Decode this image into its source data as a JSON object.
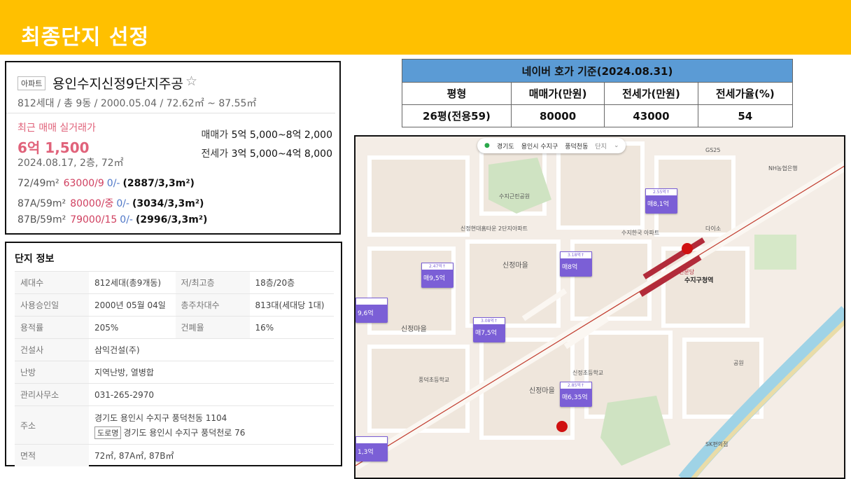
{
  "slide_title": "최종단지 선정",
  "listing": {
    "badge": "아파트",
    "name": "용인수지신정9단지주공",
    "summary": "812세대 / 총 9동 / 2000.05.04 / 72.62㎡ ~ 87.55㎡",
    "recent_label": "최근 매매 실거래가",
    "recent_price": "6억 1,500",
    "recent_date": "2024.08.17, 2층, 72㎡",
    "sale_range_label": "매매가",
    "sale_range": "5억 5,000~8억 2,000",
    "jeonse_range_label": "전세가",
    "jeonse_range": "3억 5,000~4억 8,000",
    "units": [
      {
        "type": "72/49m²",
        "sale": "63000/9",
        "jeonse": "0/-",
        "per": "(2887/3,3m²)"
      },
      {
        "type": "87A/59m²",
        "sale": "80000/중",
        "jeonse": "0/-",
        "per": "(3034/3,3m²)"
      },
      {
        "type": "87B/59m²",
        "sale": "79000/15",
        "jeonse": "0/-",
        "per": "(2996/3,3m²)"
      }
    ]
  },
  "complex_info": {
    "header": "단지 정보",
    "rows": [
      {
        "k1": "세대수",
        "v1": "812세대(총9개동)",
        "k2": "저/최고층",
        "v2": "18층/20층"
      },
      {
        "k1": "사용승인일",
        "v1": "2000년 05월 04일",
        "k2": "총주차대수",
        "v2": "813대(세대당 1대)"
      },
      {
        "k1": "용적률",
        "v1": "205%",
        "k2": "건폐율",
        "v2": "16%"
      },
      {
        "k1": "건설사",
        "v1": "삼익건설(주)"
      },
      {
        "k1": "난방",
        "v1": "지역난방, 열병합"
      },
      {
        "k1": "관리사무소",
        "v1": "031-265-2970"
      }
    ],
    "address_label": "주소",
    "address_jibun": "경기도 용인시 수지구 풍덕천동 1104",
    "road_badge": "도로명",
    "address_road": "경기도 용인시 수지구 풍덕천로 76",
    "area_label": "면적",
    "area_value": "72㎡, 87A㎡, 87B㎡"
  },
  "price_table": {
    "caption": "네이버 호가 기준(2024.08.31)",
    "headers": [
      "평형",
      "매매가(만원)",
      "전세가(만원)",
      "전세가율(%)"
    ],
    "row": [
      "26평(전용59)",
      "80000",
      "43000",
      "54"
    ]
  },
  "map": {
    "breadcrumb": [
      "경기도",
      "용인시 수지구",
      "풍덕천동",
      "단지"
    ],
    "district_labels": [
      "신정마을",
      "신정마을",
      "신정마을"
    ],
    "station": "수지구청역",
    "station_tag": "신분당",
    "price_markers": [
      {
        "price": "매9,5억",
        "sub": "2.47억↑"
      },
      {
        "price": "매8억",
        "sub": "3.18억↑"
      },
      {
        "price": "매7,5억",
        "sub": "3.08억↑"
      },
      {
        "price": "매8,1억",
        "sub": "2.55억↑"
      },
      {
        "price": "매6,35억",
        "sub": "2.85억↑"
      },
      {
        "price": "9,6억",
        "sub": ""
      },
      {
        "price": "1,3억",
        "sub": ""
      }
    ],
    "poi": [
      "수지근린공원",
      "신정현대홈타운 2단지아파트",
      "수지한국 아파트",
      "풍덕초등학교",
      "신정초등학교",
      "GS25",
      "NH농협은행",
      "다이소",
      "공원",
      "SK편의점"
    ],
    "colors": {
      "marker": "#7b5fd6",
      "dot": "#d01010",
      "rail": "#b22b3a"
    }
  }
}
